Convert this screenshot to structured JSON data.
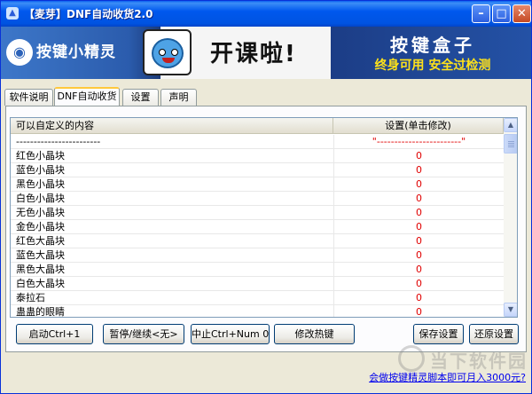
{
  "window": {
    "title": "【麦芽】DNF自动收货2.0",
    "icon": "app-icon",
    "minimize": "–",
    "maximize": "□",
    "close": "✕"
  },
  "banner": {
    "logo_text": "按键小精灵",
    "ad_title": "开课啦!",
    "ad_right_title": "按键盒子",
    "ad_right_sub": "终身可用 安全过检测"
  },
  "tabs": [
    {
      "label": "软件说明",
      "active": false
    },
    {
      "label": "DNF自动收货",
      "active": true
    },
    {
      "label": "设置",
      "active": false
    },
    {
      "label": "声明",
      "active": false
    }
  ],
  "list": {
    "headers": [
      "可以自定义的内容",
      "设置(单击修改)"
    ],
    "rows": [
      {
        "name": "------------------------",
        "value": "\"------------------------\""
      },
      {
        "name": "红色小晶块",
        "value": "0"
      },
      {
        "name": "蓝色小晶块",
        "value": "0"
      },
      {
        "name": "黑色小晶块",
        "value": "0"
      },
      {
        "name": "白色小晶块",
        "value": "0"
      },
      {
        "name": "无色小晶块",
        "value": "0"
      },
      {
        "name": "金色小晶块",
        "value": "0"
      },
      {
        "name": "红色大晶块",
        "value": "0"
      },
      {
        "name": "蓝色大晶块",
        "value": "0"
      },
      {
        "name": "黑色大晶块",
        "value": "0"
      },
      {
        "name": "白色大晶块",
        "value": "0"
      },
      {
        "name": "泰拉石",
        "value": "0"
      },
      {
        "name": "蛊蛊的眼睛",
        "value": "0"
      }
    ]
  },
  "buttons": {
    "start": "启动Ctrl+1",
    "pause": "暂停/继续<无>",
    "stop": "中止Ctrl+Num 0",
    "hotkey": "修改热键",
    "save": "保存设置",
    "restore": "还原设置"
  },
  "footer": {
    "link": "会做按键精灵脚本即可月入3000元?",
    "watermark": "当下软件园"
  },
  "colors": {
    "title_bar": "#0055e5",
    "value_red": "#e00000",
    "link_blue": "#0000ee"
  }
}
